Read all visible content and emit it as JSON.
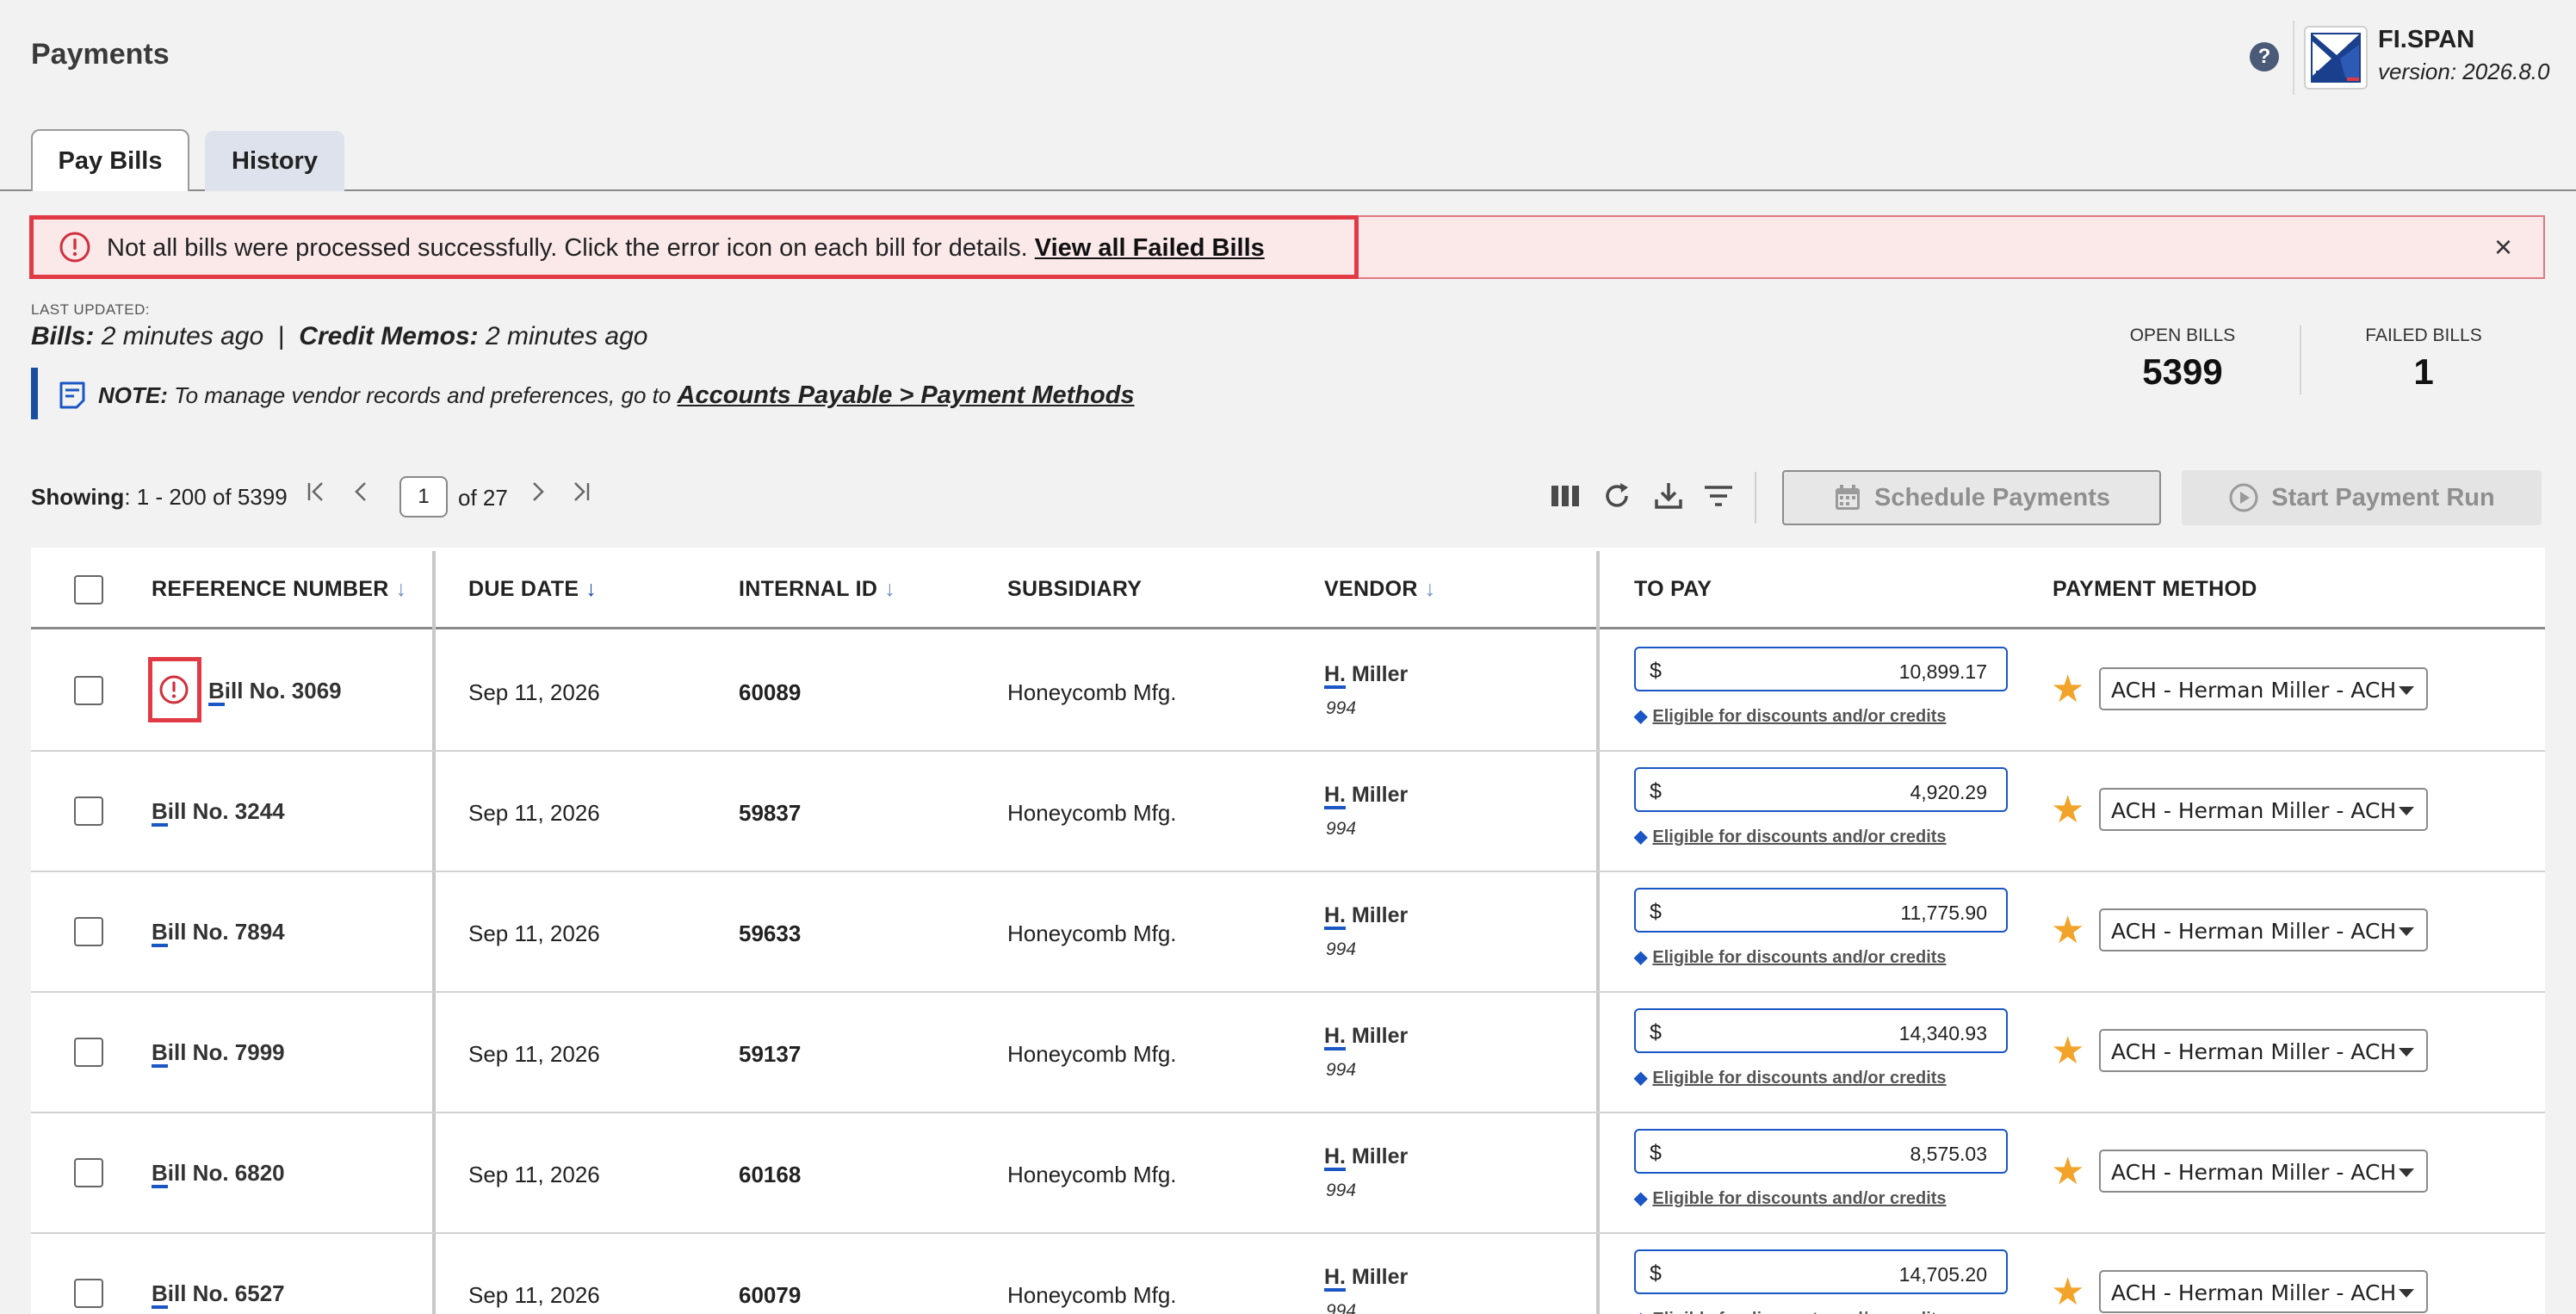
{
  "header": {
    "title": "Payments",
    "brand_name": "FI.SPAN",
    "brand_version": "version: 2026.8.0",
    "help_icon": "question-circle-icon"
  },
  "tabs": [
    {
      "label": "Pay Bills",
      "active": true
    },
    {
      "label": "History",
      "active": false
    }
  ],
  "alert": {
    "message": "Not all bills were processed successfully. Click the error icon on each bill for details.",
    "link": "View all Failed Bills",
    "icon": "error-circle-icon",
    "close_icon": "close-icon",
    "color": "#e23a45"
  },
  "updated": {
    "label": "LAST UPDATED:",
    "bills_label": "Bills:",
    "bills_value": "2 minutes ago",
    "separator": "|",
    "memos_label": "Credit Memos:",
    "memos_value": "2 minutes ago"
  },
  "note": {
    "label": "NOTE:",
    "text": "To manage vendor records and preferences, go to",
    "link": "Accounts Payable > Payment Methods"
  },
  "stats": {
    "open_label": "OPEN BILLS",
    "open_value": "5399",
    "failed_label": "FAILED BILLS",
    "failed_value": "1"
  },
  "pagination": {
    "showing_label": "Showing",
    "showing_range": ": 1 - 200 of 5399",
    "page": "1",
    "of_pages": "of 27"
  },
  "toolbar": {
    "schedule_label": "Schedule Payments",
    "start_label": "Start Payment Run"
  },
  "table": {
    "columns": [
      "REFERENCE NUMBER",
      "DUE DATE",
      "INTERNAL ID",
      "SUBSIDIARY",
      "VENDOR",
      "TO PAY",
      "PAYMENT METHOD"
    ],
    "currency": "$",
    "eligible_text": "Eligible for discounts and/or credits",
    "rows": [
      {
        "ref_prefix": "B",
        "ref_rest": "ill No. 3069",
        "due": "Sep 11, 2026",
        "id": "60089",
        "subsidiary": "Honeycomb Mfg.",
        "vendor_prefix": "H.",
        "vendor_rest": " Miller",
        "vendor_num": "994",
        "amount": "10,899.17",
        "method": "ACH - Herman Miller - ACH",
        "error": true
      },
      {
        "ref_prefix": "B",
        "ref_rest": "ill No. 3244",
        "due": "Sep 11, 2026",
        "id": "59837",
        "subsidiary": "Honeycomb Mfg.",
        "vendor_prefix": "H.",
        "vendor_rest": " Miller",
        "vendor_num": "994",
        "amount": "4,920.29",
        "method": "ACH - Herman Miller - ACH",
        "error": false
      },
      {
        "ref_prefix": "B",
        "ref_rest": "ill No. 7894",
        "due": "Sep 11, 2026",
        "id": "59633",
        "subsidiary": "Honeycomb Mfg.",
        "vendor_prefix": "H.",
        "vendor_rest": " Miller",
        "vendor_num": "994",
        "amount": "11,775.90",
        "method": "ACH - Herman Miller - ACH",
        "error": false
      },
      {
        "ref_prefix": "B",
        "ref_rest": "ill No. 7999",
        "due": "Sep 11, 2026",
        "id": "59137",
        "subsidiary": "Honeycomb Mfg.",
        "vendor_prefix": "H.",
        "vendor_rest": " Miller",
        "vendor_num": "994",
        "amount": "14,340.93",
        "method": "ACH - Herman Miller - ACH",
        "error": false
      },
      {
        "ref_prefix": "B",
        "ref_rest": "ill No. 6820",
        "due": "Sep 11, 2026",
        "id": "60168",
        "subsidiary": "Honeycomb Mfg.",
        "vendor_prefix": "H.",
        "vendor_rest": " Miller",
        "vendor_num": "994",
        "amount": "8,575.03",
        "method": "ACH - Herman Miller - ACH",
        "error": false
      },
      {
        "ref_prefix": "B",
        "ref_rest": "ill No. 6527",
        "due": "Sep 11, 2026",
        "id": "60079",
        "subsidiary": "Honeycomb Mfg.",
        "vendor_prefix": "H.",
        "vendor_rest": " Miller",
        "vendor_num": "994",
        "amount": "14,705.20",
        "method": "ACH - Herman Miller - ACH",
        "error": false
      }
    ]
  },
  "colors": {
    "accent": "#1a56c4",
    "error": "#e23a45",
    "star": "#f2a42a"
  }
}
